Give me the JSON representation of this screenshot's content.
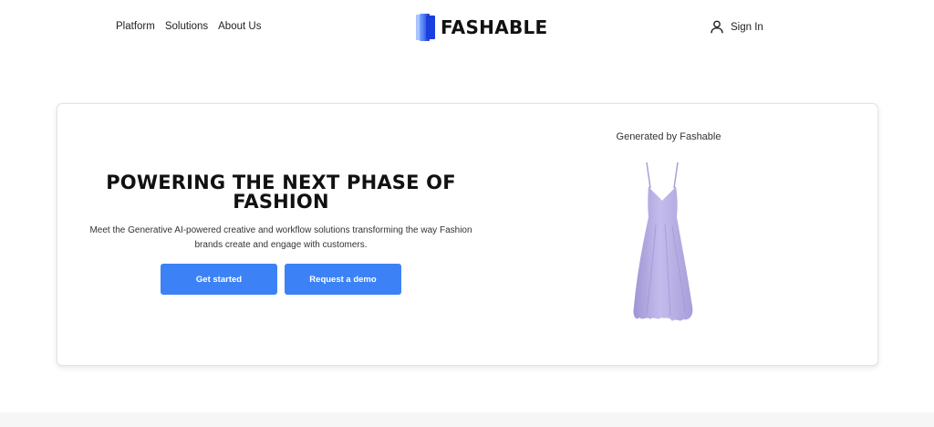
{
  "header": {
    "nav": [
      {
        "label": "Platform"
      },
      {
        "label": "Solutions"
      },
      {
        "label": "About Us"
      }
    ],
    "logo_text": "FASHABLE",
    "signin_label": "Sign In",
    "icons": {
      "logo": "fashable-logo-mark",
      "user": "user-icon"
    }
  },
  "hero": {
    "title": "POWERING THE NEXT PHASE OF FASHION",
    "description": "Meet the Generative AI-powered creative and workflow solutions transforming the way Fashion brands create and engage with customers.",
    "primary_button": "Get started",
    "secondary_button": "Request a demo",
    "image_caption": "Generated by Fashable"
  },
  "colors": {
    "accent": "#3c82f6",
    "logo_blue": "#1a3fe0",
    "dress": "#b9b0e2"
  }
}
